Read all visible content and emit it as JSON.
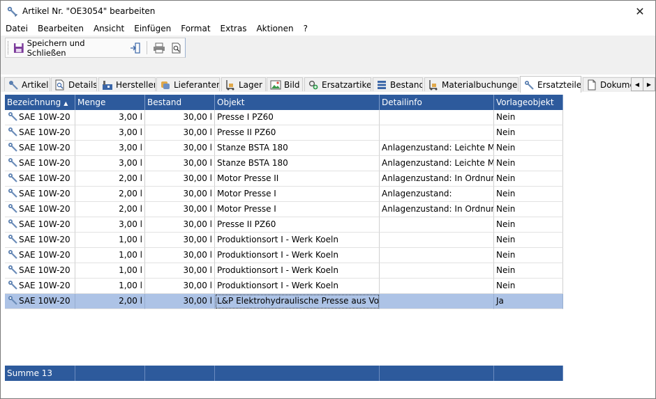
{
  "window": {
    "title": "Artikel Nr. \"OE3054\" bearbeiten",
    "close_glyph": "✕",
    "icon": "wrench-gear-icon"
  },
  "menu": {
    "items": [
      "Datei",
      "Bearbeiten",
      "Ansicht",
      "Einfügen",
      "Format",
      "Extras",
      "Aktionen",
      "?"
    ]
  },
  "toolbar": {
    "save_label": "Speichern und Schließen"
  },
  "tabs": [
    {
      "label": "Artikel",
      "icon": "wrench-gear-icon"
    },
    {
      "label": "Details",
      "icon": "document-search-icon"
    },
    {
      "label": "Hersteller",
      "icon": "factory-icon"
    },
    {
      "label": "Lieferanten",
      "icon": "handshake-icon"
    },
    {
      "label": "Lager",
      "icon": "forklift-icon"
    },
    {
      "label": "Bild",
      "icon": "picture-icon"
    },
    {
      "label": "Ersatzartikel",
      "icon": "swap-gear-icon"
    },
    {
      "label": "Bestand",
      "icon": "stack-icon"
    },
    {
      "label": "Materialbuchungen",
      "icon": "forklift-icon"
    },
    {
      "label": "Ersatzteile",
      "icon": "wrench-gear-icon",
      "active": true
    },
    {
      "label": "Dokumente",
      "icon": "document-icon"
    }
  ],
  "grid": {
    "columns": [
      "Bezeichnung",
      "Menge",
      "Bestand",
      "Objekt",
      "Detailinfo",
      "Vorlageobjekt"
    ],
    "sort_column": "Bezeichnung",
    "sort_glyph": "▲",
    "rows": [
      [
        "SAE 10W-20",
        "3,00 l",
        "30,00 l",
        "Presse I PZ60",
        "",
        "Nein"
      ],
      [
        "SAE 10W-20",
        "3,00 l",
        "30,00 l",
        "Presse II PZ60",
        "",
        "Nein"
      ],
      [
        "SAE 10W-20",
        "3,00 l",
        "30,00 l",
        "Stanze BSTA 180",
        "Anlagenzustand: Leichte Mä...",
        "Nein"
      ],
      [
        "SAE 10W-20",
        "3,00 l",
        "30,00 l",
        "Stanze BSTA 180",
        "Anlagenzustand: Leichte Mä...",
        "Nein"
      ],
      [
        "SAE 10W-20",
        "2,00 l",
        "30,00 l",
        "Motor Presse II",
        "Anlagenzustand: In Ordnung",
        "Nein"
      ],
      [
        "SAE 10W-20",
        "2,00 l",
        "30,00 l",
        "Motor Presse I",
        "Anlagenzustand:",
        "Nein"
      ],
      [
        "SAE 10W-20",
        "2,00 l",
        "30,00 l",
        "Motor Presse I",
        "Anlagenzustand: In Ordnung",
        "Nein"
      ],
      [
        "SAE 10W-20",
        "3,00 l",
        "30,00 l",
        "Presse II PZ60",
        "",
        "Nein"
      ],
      [
        "SAE 10W-20",
        "1,00 l",
        "30,00 l",
        "Produktionsort I - Werk Koeln",
        "",
        "Nein"
      ],
      [
        "SAE 10W-20",
        "1,00 l",
        "30,00 l",
        "Produktionsort I - Werk Koeln",
        "",
        "Nein"
      ],
      [
        "SAE 10W-20",
        "1,00 l",
        "30,00 l",
        "Produktionsort I - Werk Koeln",
        "",
        "Nein"
      ],
      [
        "SAE 10W-20",
        "1,00 l",
        "30,00 l",
        "Produktionsort I - Werk Koeln",
        "",
        "Nein"
      ],
      [
        "SAE 10W-20",
        "2,00 l",
        "30,00 l",
        "L&P Elektrohydraulische Presse aus Vorlage",
        "",
        "Ja"
      ]
    ],
    "selected_row": 12,
    "summary": "Summe 13"
  }
}
